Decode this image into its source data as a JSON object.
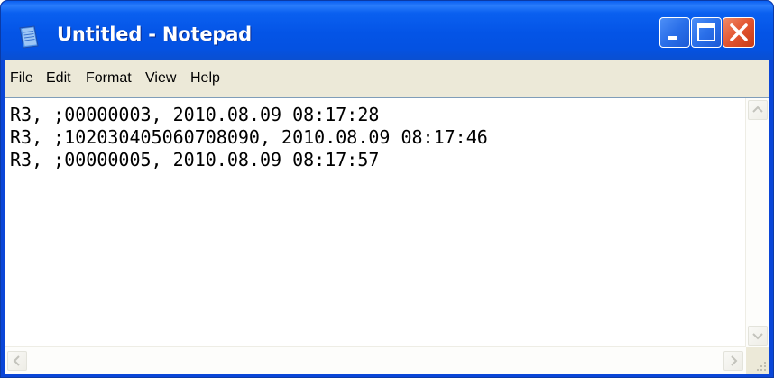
{
  "window": {
    "title": "Untitled - Notepad",
    "controls": [
      "minimize",
      "maximize",
      "close"
    ]
  },
  "menu": {
    "items": [
      "File",
      "Edit",
      "Format",
      "View",
      "Help"
    ]
  },
  "editor": {
    "lines": [
      "R3, ;00000003, 2010.08.09 08:17:28",
      "R3, ;102030405060708090, 2010.08.09 08:17:46",
      "R3, ;00000005, 2010.08.09 08:17:57"
    ]
  },
  "colors": {
    "titlebar": "#0a5ff2",
    "close_button": "#e2542f",
    "menubar": "#ece9d8",
    "text": "#000000"
  }
}
